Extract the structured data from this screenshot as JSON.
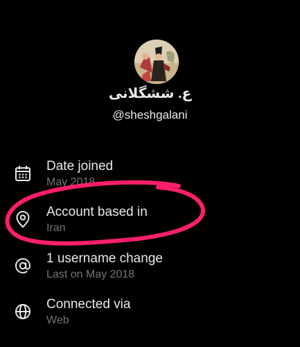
{
  "profile": {
    "display_name": "ع. ششگلانی",
    "handle": "@sheshgalani"
  },
  "details": [
    {
      "icon": "calendar-icon",
      "title": "Date joined",
      "value": "May 2018"
    },
    {
      "icon": "location-pin-icon",
      "title": "Account based in",
      "value": "Iran"
    },
    {
      "icon": "at-sign-icon",
      "title": "1 username change",
      "value": "Last on May 2018"
    },
    {
      "icon": "globe-icon",
      "title": "Connected via",
      "value": "Web"
    }
  ],
  "colors": {
    "background": "#000000",
    "primary_text": "#e7e9ea",
    "secondary_text": "#71767b",
    "highlight_circle": "#ff1f6b"
  }
}
